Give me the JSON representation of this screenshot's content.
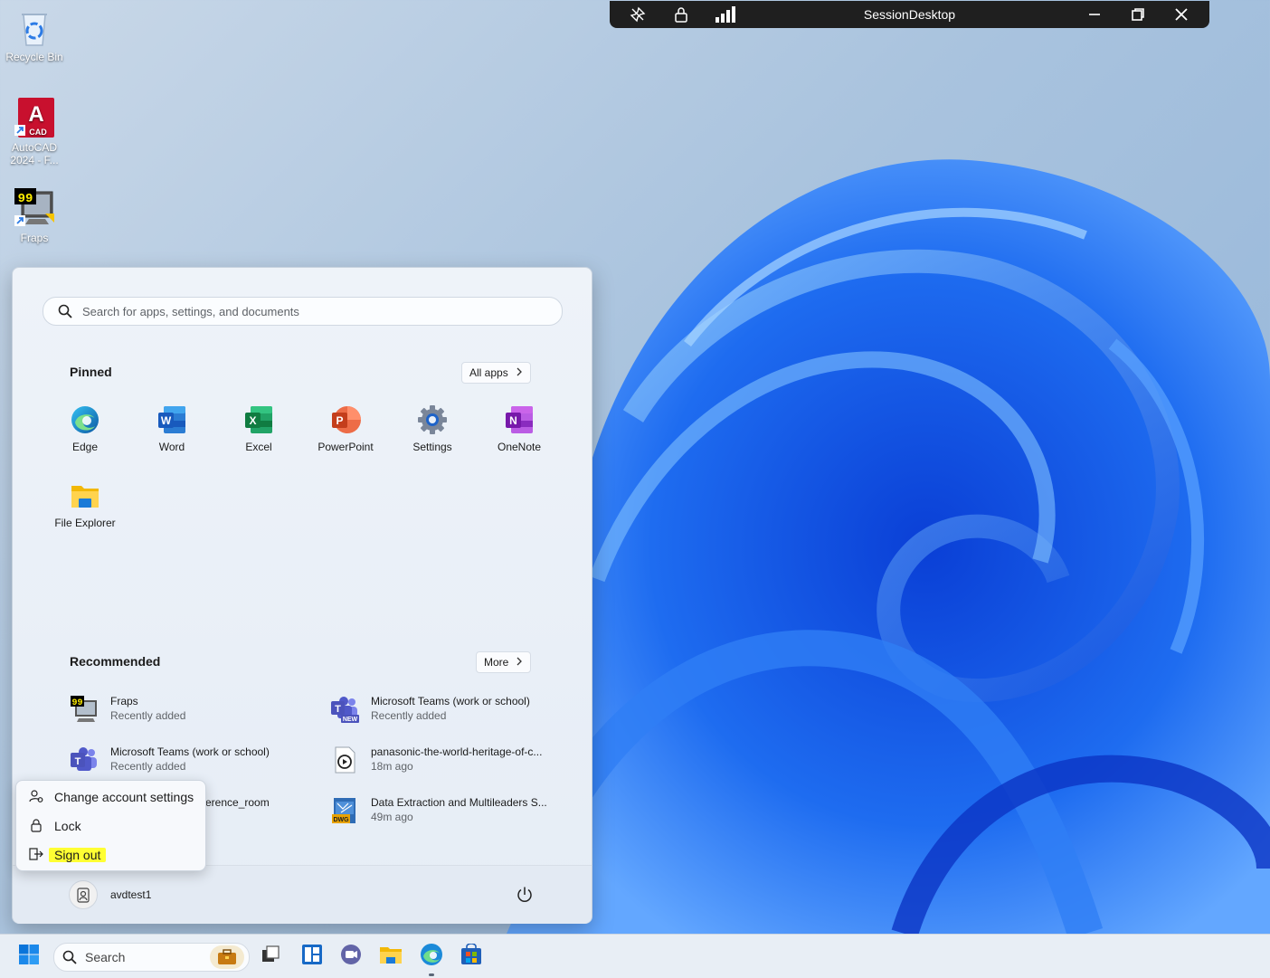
{
  "session": {
    "title": "SessionDesktop"
  },
  "desktop": {
    "icons": [
      {
        "label": "Recycle Bin"
      },
      {
        "label": "AutoCAD 2024 - F..."
      },
      {
        "label": "Fraps"
      }
    ]
  },
  "start": {
    "search_placeholder": "Search for apps, settings, and documents",
    "pinned_title": "Pinned",
    "all_apps": "All apps",
    "pinned": [
      {
        "label": "Edge"
      },
      {
        "label": "Word"
      },
      {
        "label": "Excel"
      },
      {
        "label": "PowerPoint"
      },
      {
        "label": "Settings"
      },
      {
        "label": "OneNote"
      },
      {
        "label": "File Explorer"
      }
    ],
    "recommended_title": "Recommended",
    "more": "More",
    "recommended": [
      {
        "title": "Fraps",
        "sub": "Recently added"
      },
      {
        "title": "Microsoft Teams (work or school)",
        "sub": "Recently added"
      },
      {
        "title": "Microsoft Teams (work or school)",
        "sub": "Recently added"
      },
      {
        "title": "panasonic-the-world-heritage-of-c...",
        "sub": "18m ago"
      },
      {
        "title": "erence_room",
        "sub": ""
      },
      {
        "title": "Data Extraction and Multileaders S...",
        "sub": "49m ago"
      }
    ],
    "user": "avdtest1"
  },
  "account_menu": {
    "change": "Change account settings",
    "lock": "Lock",
    "sign_out": "Sign out"
  },
  "taskbar": {
    "search_placeholder": "Search"
  },
  "colors": {
    "accent": "#0067c0",
    "highlight": "#ffff33"
  }
}
